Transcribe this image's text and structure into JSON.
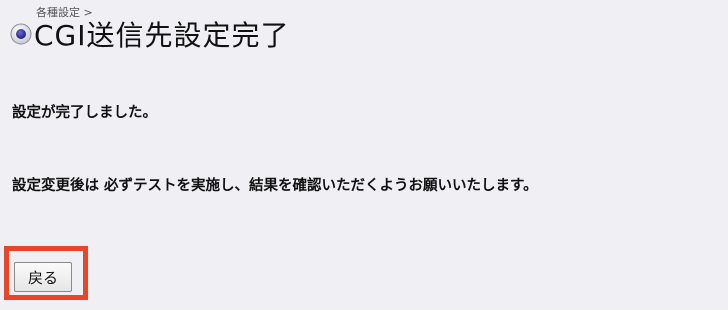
{
  "header": {
    "breadcrumb": "各種設定 >",
    "title": "CGI送信先設定完了"
  },
  "messages": {
    "complete": "設定が完了しました。",
    "notice": "設定変更後は 必ずテストを実施し、結果を確認いただくようお願いいたします。"
  },
  "buttons": {
    "back_label": "戻る"
  },
  "colors": {
    "background": "#efeff4",
    "highlight": "#e8452a"
  }
}
